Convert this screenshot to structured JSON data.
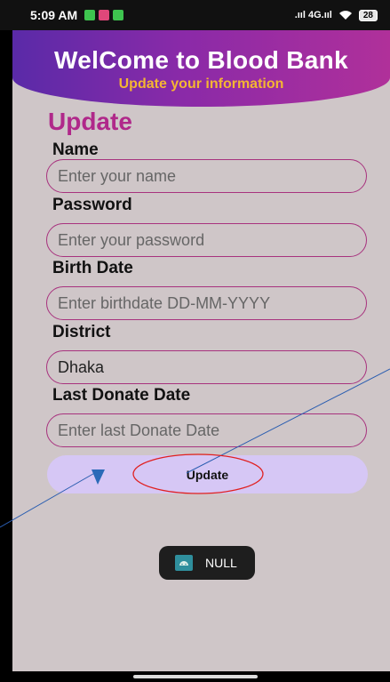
{
  "status_bar": {
    "time": "5:09 AM",
    "network": ".ııl 4G.ııl",
    "battery": "28"
  },
  "header": {
    "title": "WelCome to Blood Bank",
    "subtitle": "Update your information"
  },
  "form": {
    "heading": "Update",
    "fields": [
      {
        "label": "Name",
        "placeholder": "Enter your name",
        "value": ""
      },
      {
        "label": "Password",
        "placeholder": "Enter your password",
        "value": ""
      },
      {
        "label": "Birth Date",
        "placeholder": "Enter birthdate DD-MM-YYYY",
        "value": ""
      },
      {
        "label": "District",
        "placeholder": "",
        "value": "Dhaka"
      },
      {
        "label": "Last Donate Date",
        "placeholder": "Enter last Donate Date",
        "value": ""
      }
    ],
    "submit_label": "Update"
  },
  "toast": {
    "text": "NULL"
  },
  "colors": {
    "header_gradient_start": "#5a2aa8",
    "header_gradient_end": "#b0309a",
    "subtitle": "#f4b632",
    "heading": "#b0288a",
    "field_border": "#a8327e",
    "button_bg": "#d6c7f5",
    "background": "#cfc6c8"
  }
}
